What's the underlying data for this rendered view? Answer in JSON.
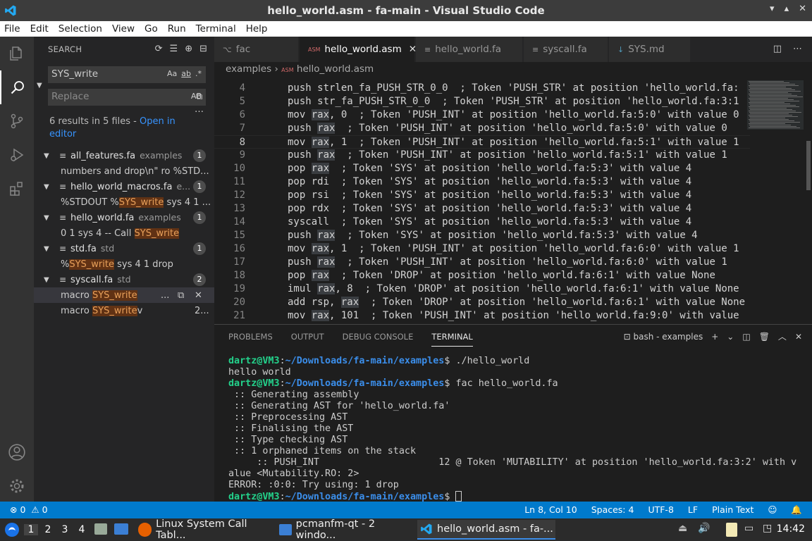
{
  "window": {
    "title": "hello_world.asm - fa-main - Visual Studio Code"
  },
  "menu": [
    "File",
    "Edit",
    "Selection",
    "View",
    "Go",
    "Run",
    "Terminal",
    "Help"
  ],
  "search": {
    "header": "SEARCH",
    "query": "SYS_write",
    "replace_placeholder": "Replace",
    "case_opt": "Aa",
    "word_opt": "ab",
    "regex_opt": ".*",
    "preserve_case": "AB",
    "summary": "6 results in 5 files - ",
    "open_in_editor": "Open in editor",
    "results": [
      {
        "file": "all_features.fa",
        "dir": "examples",
        "count": "1",
        "matches": [
          {
            "pre": "numbers and drop\\n\" ro %STD...",
            "hit": "",
            "post": ""
          }
        ]
      },
      {
        "file": "hello_world_macros.fa",
        "dir": "e...",
        "count": "1",
        "matches": [
          {
            "pre": "%STDOUT %",
            "hit": "SYS_write",
            "post": " sys 4 1 ..."
          }
        ]
      },
      {
        "file": "hello_world.fa",
        "dir": "examples",
        "count": "1",
        "matches": [
          {
            "pre": "0 1 sys 4    -- Call ",
            "hit": "SYS_write",
            "post": ""
          }
        ]
      },
      {
        "file": "std.fa",
        "dir": "std",
        "count": "1",
        "matches": [
          {
            "pre": "%",
            "hit": "SYS_write",
            "post": " sys 4 1 drop"
          }
        ]
      },
      {
        "file": "syscall.fa",
        "dir": "std",
        "count": "2",
        "matches": [
          {
            "pre": "macro ",
            "hit": "SYS_write",
            "post": "",
            "tail": "..."
          },
          {
            "pre": "macro ",
            "hit": "SYS_write",
            "post": "v",
            "tail": "2..."
          }
        ]
      }
    ]
  },
  "tabs": [
    {
      "label": "fac",
      "icon": "⌥"
    },
    {
      "label": "hello_world.asm",
      "icon": "ASM"
    },
    {
      "label": "hello_world.fa",
      "icon": "≡"
    },
    {
      "label": "syscall.fa",
      "icon": "≡"
    },
    {
      "label": "SYS.md",
      "icon": "↓"
    }
  ],
  "breadcrumb": {
    "folder": "examples",
    "sep": "›",
    "file": "hello_world.asm"
  },
  "editor": {
    "lines": [
      {
        "n": "4",
        "pre": "push strlen_fa_PUSH_STR_0_0  ; Token 'PUSH_STR' at position 'hello_world.fa:"
      },
      {
        "n": "5",
        "pre": "push str_fa_PUSH_STR_0_0  ; Token 'PUSH_STR' at position 'hello_world.fa:3:1"
      },
      {
        "n": "6",
        "pre": "mov ",
        "reg": "rax",
        "post": ", 0  ; Token 'PUSH_INT' at position 'hello_world.fa:5:0' with value 0"
      },
      {
        "n": "7",
        "pre": "push ",
        "reg": "rax",
        "post": "  ; Token 'PUSH_INT' at position 'hello_world.fa:5:0' with value 0"
      },
      {
        "n": "8",
        "pre": "mov ",
        "reg": "rax",
        "post": ", 1  ; Token 'PUSH_INT' at position 'hello_world.fa:5:1' with value 1"
      },
      {
        "n": "9",
        "pre": "push ",
        "reg": "rax",
        "post": "  ; Token 'PUSH_INT' at position 'hello_world.fa:5:1' with value 1"
      },
      {
        "n": "10",
        "pre": "pop ",
        "reg": "rax",
        "post": "  ; Token 'SYS' at position 'hello_world.fa:5:3' with value 4"
      },
      {
        "n": "11",
        "pre": "pop rdi  ; Token 'SYS' at position 'hello_world.fa:5:3' with value 4"
      },
      {
        "n": "12",
        "pre": "pop rsi  ; Token 'SYS' at position 'hello_world.fa:5:3' with value 4"
      },
      {
        "n": "13",
        "pre": "pop rdx  ; Token 'SYS' at position 'hello_world.fa:5:3' with value 4"
      },
      {
        "n": "14",
        "pre": "syscall  ; Token 'SYS' at position 'hello_world.fa:5:3' with value 4"
      },
      {
        "n": "15",
        "pre": "push ",
        "reg": "rax",
        "post": "  ; Token 'SYS' at position 'hello_world.fa:5:3' with value 4"
      },
      {
        "n": "16",
        "pre": "mov ",
        "reg": "rax",
        "post": ", 1  ; Token 'PUSH_INT' at position 'hello_world.fa:6:0' with value 1"
      },
      {
        "n": "17",
        "pre": "push ",
        "reg": "rax",
        "post": "  ; Token 'PUSH_INT' at position 'hello_world.fa:6:0' with value 1"
      },
      {
        "n": "18",
        "pre": "pop ",
        "reg": "rax",
        "post": "  ; Token 'DROP' at position 'hello_world.fa:6:1' with value None"
      },
      {
        "n": "19",
        "pre": "imul ",
        "reg": "rax",
        "post": ", 8  ; Token 'DROP' at position 'hello_world.fa:6:1' with value None"
      },
      {
        "n": "20",
        "pre": "add rsp, ",
        "reg": "rax",
        "post": "  ; Token 'DROP' at position 'hello_world.fa:6:1' with value None"
      },
      {
        "n": "21",
        "pre": "mov ",
        "reg": "rax",
        "post": ", 101  ; Token 'PUSH_INT' at position 'hello_world.fa:9:0' with value"
      }
    ],
    "current_line": "8"
  },
  "panel": {
    "tabs": [
      "PROBLEMS",
      "OUTPUT",
      "DEBUG CONSOLE",
      "TERMINAL"
    ],
    "active_tab": "TERMINAL",
    "terminal_name": "bash - examples"
  },
  "terminal": {
    "user": "dartz@VM3",
    "path": "~/Downloads/fa-main/examples",
    "lines": [
      {
        "prompt": true,
        "cmd": "$ ./hello_world"
      },
      {
        "text": "hello world"
      },
      {
        "prompt": true,
        "cmd": "$ fac hello_world.fa"
      },
      {
        "text": " :: Generating assembly"
      },
      {
        "text": " :: Generating AST for 'hello_world.fa'"
      },
      {
        "text": " :: Preprocessing AST"
      },
      {
        "text": " :: Finalising the AST"
      },
      {
        "text": " :: Type checking AST"
      },
      {
        "text": " :: 1 orphaned items on the stack"
      },
      {
        "text": "     :: PUSH_INT                     12 @ Token 'MUTABILITY' at position 'hello_world.fa:3:2' with v"
      },
      {
        "text": "alue <Mutability.RO: 2>"
      },
      {
        "text": "ERROR: :0:0: Try using: 1 drop"
      },
      {
        "prompt": true,
        "cmd": "$ "
      }
    ]
  },
  "status": {
    "errors": "0",
    "warnings": "0",
    "position": "Ln 8, Col 10",
    "spaces": "Spaces: 4",
    "encoding": "UTF-8",
    "eol": "LF",
    "language": "Plain Text"
  },
  "taskbar": {
    "workspaces": [
      "1",
      "2",
      "3",
      "4"
    ],
    "tasks": [
      {
        "label": "Linux System Call Tabl..."
      },
      {
        "label": "pcmanfm-qt - 2 windo..."
      },
      {
        "label": "hello_world.asm - fa-..."
      }
    ],
    "clock": "14:42"
  },
  "colors": {
    "accent": "#007acc",
    "match_bg": "#613214",
    "prompt_user": "#23d18b",
    "prompt_path": "#3b8eea"
  }
}
